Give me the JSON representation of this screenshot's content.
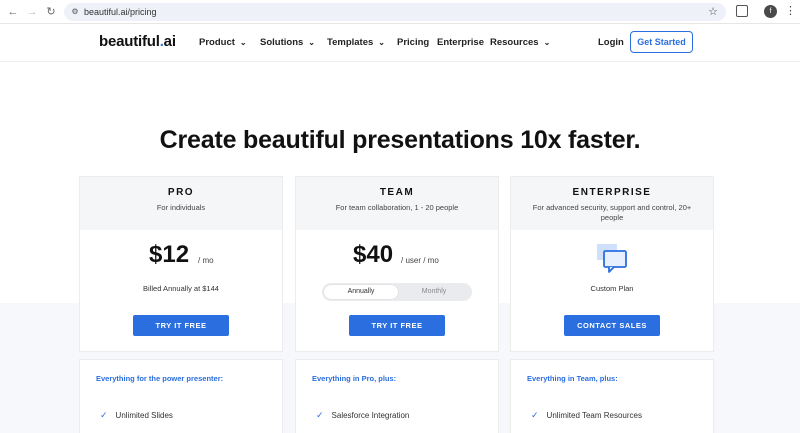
{
  "browser": {
    "url": "beautiful.ai/pricing",
    "back_icon": "back-arrow-icon",
    "forward_icon": "forward-arrow-icon",
    "reload_icon": "reload-icon",
    "profile_initial": "f"
  },
  "header": {
    "logo_text": "beautiful",
    "logo_dot": ".",
    "logo_suffix": "ai",
    "nav": [
      {
        "label": "Product"
      },
      {
        "label": "Solutions"
      },
      {
        "label": "Templates"
      },
      {
        "label": "Pricing"
      },
      {
        "label": "Enterprise"
      },
      {
        "label": "Resources"
      }
    ],
    "login": "Login",
    "get_started": "Get Started"
  },
  "hero": {
    "headline": "Create beautiful presentations 10x faster."
  },
  "plans": [
    {
      "name": "PRO",
      "subtitle": "For individuals",
      "price": "$12",
      "period": "/ mo",
      "billing": "Billed Annually at $144",
      "cta": "TRY IT FREE"
    },
    {
      "name": "TEAM",
      "subtitle": "For team collaboration, 1 - 20 people",
      "price": "$40",
      "period": "/ user / mo",
      "toggle": {
        "annually": "Annually",
        "monthly": "Monthly",
        "selected": "Annually"
      },
      "cta": "TRY IT FREE"
    },
    {
      "name": "ENTERPRISE",
      "subtitle": "For advanced security, support and control, 20+ people",
      "custom": "Custom Plan",
      "cta": "CONTACT SALES"
    }
  ],
  "features": [
    {
      "heading": "Everything for the power presenter:",
      "first_item": "Unlimited Slides"
    },
    {
      "heading": "Everything in Pro, plus:",
      "first_item": "Salesforce Integration"
    },
    {
      "heading": "Everything in Team, plus:",
      "first_item": "Unlimited Team Resources"
    }
  ],
  "colors": {
    "brand_blue": "#2a6ee0",
    "card_header_bg": "#f5f6f8"
  }
}
